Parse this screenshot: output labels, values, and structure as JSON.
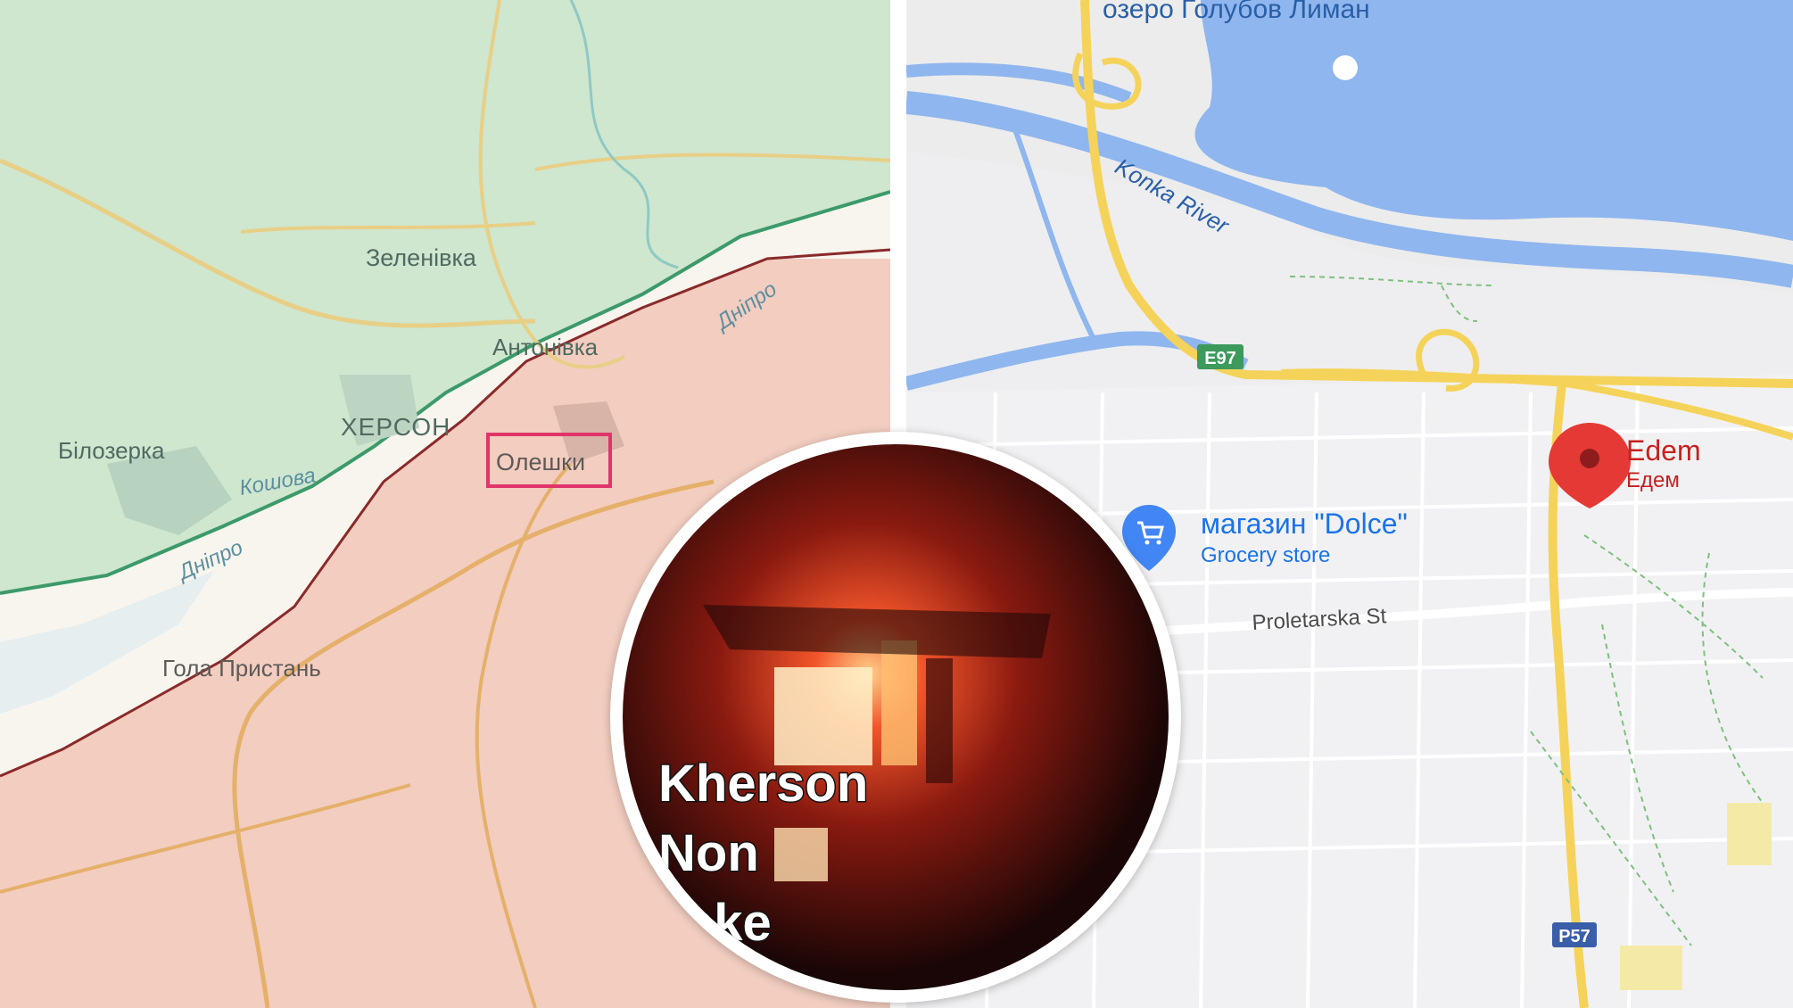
{
  "left_map": {
    "place_labels": {
      "zelenivka": "Зеленівка",
      "antonivka": "Антонівка",
      "kherson": "ХЕРСОН",
      "bilozerka": "Білозерка",
      "oleshky": "Олешки",
      "hola_prystan": "Гола Пристань"
    },
    "river_labels": {
      "dnipro_upper": "Дніпро",
      "dnipro_lower": "Дніпро",
      "koshova": "Кошова"
    },
    "colors": {
      "ukraine_controlled": "#cfe6cf",
      "occupied": "#f2cdc0",
      "highlight_box": "#e0356a"
    }
  },
  "right_map": {
    "labels": {
      "lake": "озеро Голубов Лиман",
      "river": "Konka River",
      "road_e97": "E97",
      "road_p57": "P57",
      "street": "Proletarska St",
      "poi_name": "магазин \"Dolce\"",
      "poi_category": "Grocery store",
      "pin_name": "Edem",
      "pin_subname": "Едем"
    },
    "icons": {
      "poi": "shopping-cart-icon",
      "pin": "location-pin-icon"
    },
    "colors": {
      "water": "#8fb6ee",
      "highway": "#f5d35a",
      "pin": "#e53935"
    }
  },
  "inset": {
    "caption_line1": "Kherson",
    "caption_line2": "Non",
    "caption_line3": "ake"
  }
}
